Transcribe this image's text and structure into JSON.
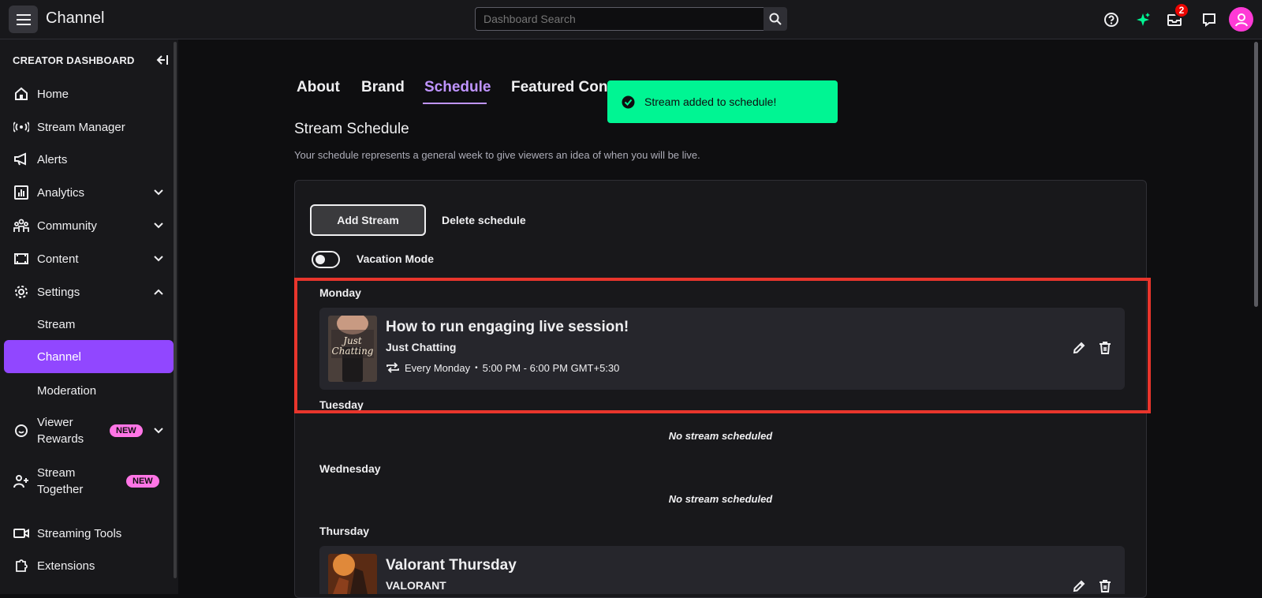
{
  "header": {
    "title": "Channel",
    "search_placeholder": "Dashboard Search",
    "notification_count": "2"
  },
  "sidebar": {
    "heading": "CREATOR DASHBOARD",
    "items": [
      {
        "label": "Home",
        "icon": "home-icon"
      },
      {
        "label": "Stream Manager",
        "icon": "broadcast-icon"
      },
      {
        "label": "Alerts",
        "icon": "megaphone-icon"
      },
      {
        "label": "Analytics",
        "icon": "chart-icon"
      },
      {
        "label": "Community",
        "icon": "people-icon"
      },
      {
        "label": "Content",
        "icon": "content-icon"
      },
      {
        "label": "Settings",
        "icon": "gear-icon"
      },
      {
        "label": "Stream"
      },
      {
        "label": "Channel"
      },
      {
        "label": "Moderation"
      },
      {
        "label": "Viewer Rewards",
        "icon": "smile-icon",
        "badge": "NEW"
      },
      {
        "label": "Stream Together",
        "icon": "add-person-icon",
        "badge": "NEW"
      },
      {
        "label": "Streaming Tools",
        "icon": "camera-icon"
      },
      {
        "label": "Extensions",
        "icon": "puzzle-icon"
      }
    ]
  },
  "tabs": [
    "About",
    "Brand",
    "Schedule",
    "Featured Cont"
  ],
  "toast": {
    "message": "Stream added to schedule!"
  },
  "schedule": {
    "title": "Stream Schedule",
    "description": "Your schedule represents a general week to give viewers an idea of when you will be live.",
    "add_label": "Add Stream",
    "delete_label": "Delete schedule",
    "vacation_label": "Vacation Mode",
    "empty_text": "No stream scheduled",
    "days": {
      "monday": "Monday",
      "tuesday": "Tuesday",
      "wednesday": "Wednesday",
      "thursday": "Thursday"
    },
    "streams": [
      {
        "title": "How to run engaging live session!",
        "category": "Just Chatting",
        "thumb_text": "Just Chatting",
        "repeat": "Every Monday",
        "time": "5:00 PM - 6:00 PM GMT+5:30"
      },
      {
        "title": "Valorant Thursday",
        "category": "VALORANT"
      }
    ]
  },
  "colors": {
    "accent": "#9147ff",
    "tab_active": "#bf94ff",
    "toast": "#00f593",
    "highlight": "#e8352c",
    "new_badge": "#ff75e6"
  }
}
